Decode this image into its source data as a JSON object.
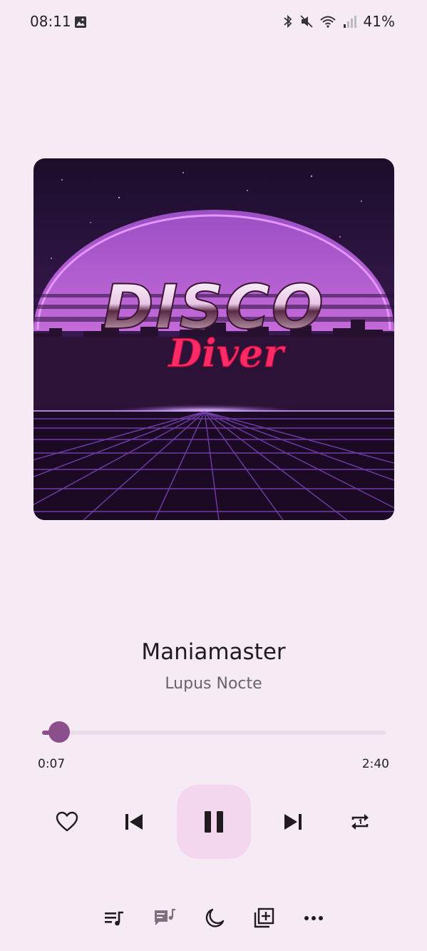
{
  "status_bar": {
    "time": "08:11",
    "battery": "41%",
    "icons": [
      "gallery-icon",
      "bluetooth-icon",
      "mute-icon",
      "wifi-icon",
      "signal-icon"
    ]
  },
  "album_art": {
    "title_text": "DISCO",
    "script_text": "Diver"
  },
  "track": {
    "title": "Maniamaster",
    "artist": "Lupus Nocte"
  },
  "progress": {
    "elapsed": "0:07",
    "total": "2:40",
    "fraction": 0.05
  },
  "controls": [
    "favorite-heart-icon",
    "skip-previous-icon",
    "pause-icon",
    "skip-next-icon",
    "repeat-one-icon"
  ],
  "bottom_bar": [
    "queue-icon",
    "lyrics-icon",
    "sleep-timer-icon",
    "add-to-playlist-icon",
    "more-icon"
  ],
  "colors": {
    "background": "#f6eaf5",
    "accent": "#8b4f8c",
    "play_button_bg": "#f5d6ef"
  }
}
